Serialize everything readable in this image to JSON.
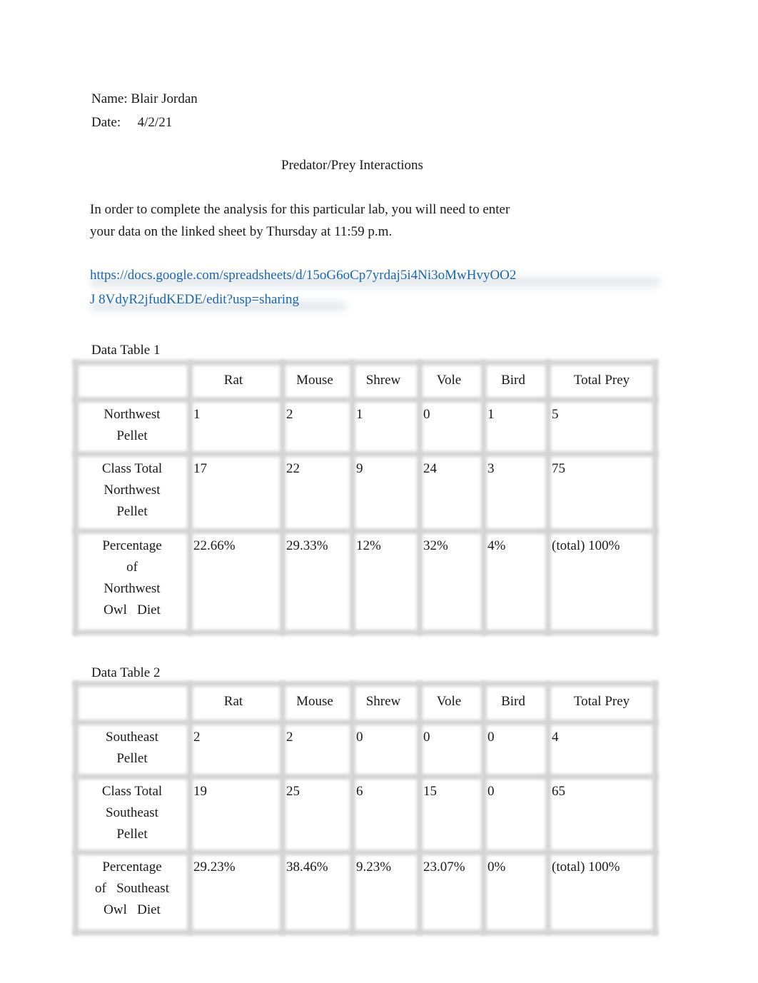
{
  "header": {
    "name_label": "Name:",
    "name_value": "Blair Jordan",
    "date_label": "Date:",
    "date_value": "4/2/21"
  },
  "title": "Predator/Prey Interactions",
  "instructions": {
    "line1": "In order to complete the analysis for this particular lab, you will need to enter",
    "line2": "your data on the linked sheet by Thursday at 11:59 p.m."
  },
  "link": {
    "line1": "https://docs.google.com/spreadsheets/d/15oG6oCp7yrdaj5i4Ni3oMwHvyOO2",
    "line2": "J 8VdyR2jfudKEDE/edit?usp=sharing"
  },
  "tables": [
    {
      "caption": "Data Table 1",
      "columns": [
        "",
        "Rat",
        "Mouse",
        "Shrew",
        "Vole",
        "Bird",
        "Total Prey"
      ],
      "rows": [
        {
          "label": [
            "Northwest",
            "Pellet"
          ],
          "values": [
            "1",
            "2",
            "1",
            "0",
            "1",
            "5"
          ]
        },
        {
          "label": [
            "Class Total",
            "Northwest",
            "Pellet"
          ],
          "values": [
            "17",
            "22",
            "9",
            "24",
            "3",
            "75"
          ]
        },
        {
          "label": [
            "Percentage",
            "of",
            "Northwest",
            "Owl   Diet"
          ],
          "values": [
            "22.66%",
            "29.33%",
            "12%",
            "32%",
            "4%",
            "(total) 100%"
          ]
        }
      ]
    },
    {
      "caption": "Data Table 2",
      "columns": [
        "",
        "Rat",
        "Mouse",
        "Shrew",
        "Vole",
        "Bird",
        "Total Prey"
      ],
      "rows": [
        {
          "label": [
            "Southeast",
            "Pellet"
          ],
          "values": [
            "2",
            "2",
            "0",
            "0",
            "0",
            "4"
          ]
        },
        {
          "label": [
            "Class Total",
            "Southeast",
            "Pellet"
          ],
          "values": [
            "19",
            "25",
            "6",
            "15",
            "0",
            "65"
          ]
        },
        {
          "label": [
            "Percentage",
            "of   Southeast",
            "Owl   Diet"
          ],
          "values": [
            "29.23%",
            "38.46%",
            "9.23%",
            "23.07%",
            "0%",
            "(total) 100%"
          ]
        }
      ]
    }
  ]
}
